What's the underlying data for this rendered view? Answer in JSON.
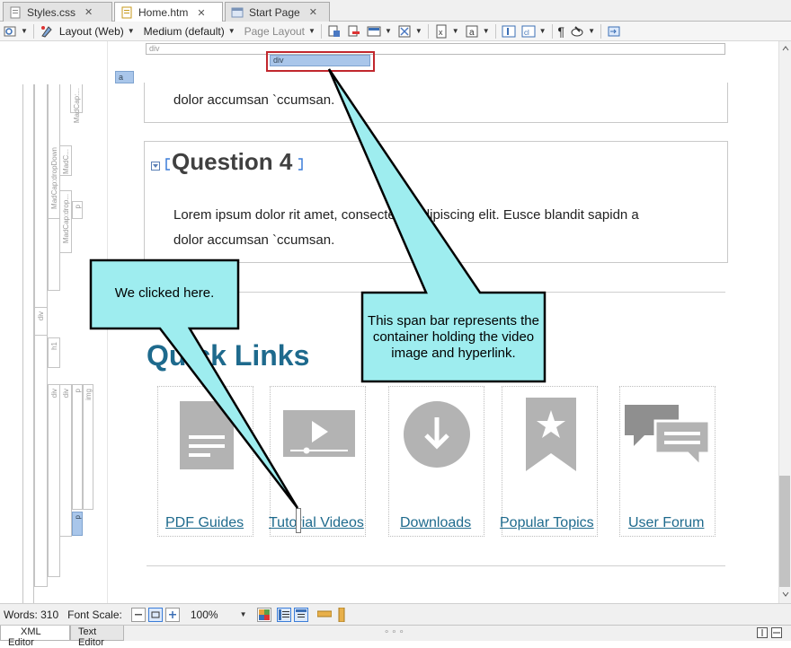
{
  "tabs": [
    {
      "label": "Styles.css",
      "icon": "css-file-icon",
      "active": false
    },
    {
      "label": "Home.htm",
      "icon": "htm-file-icon",
      "active": true
    },
    {
      "label": "Start Page",
      "icon": "start-page-icon",
      "active": false
    }
  ],
  "tab_close_glyph": "✕",
  "toolbar": {
    "layout_label": "Layout (Web)",
    "medium_label": "Medium (default)",
    "page_layout_label": "Page Layout",
    "pilcrow": "¶"
  },
  "structure": {
    "div_bar_label": "div",
    "span_bar_label": "div",
    "a_tag_label": "a",
    "gutter_labels": [
      "MadCap:...",
      "MadCap:dropDown",
      "MadC...",
      "MadCap:drop...",
      "p",
      "MadCap:drop...",
      "div",
      "h1",
      "div",
      "div",
      "p",
      "img",
      "p"
    ]
  },
  "content": {
    "prev_answer_tail": "dolor accumsan `ccumsan.",
    "q4_title": "Question 4",
    "q4_line1": "Lorem ipsum dolor rit amet, consectetur adipiscing elit. Eusce blandit sapidn a",
    "q4_line2": "dolor accumsan `ccumsan.",
    "quick_links_title": "Quick Links",
    "cards": [
      {
        "label": "PDF Guides",
        "icon": "document-icon"
      },
      {
        "label": "Tutorial Videos",
        "icon": "video-player-icon"
      },
      {
        "label": "Downloads",
        "icon": "download-icon"
      },
      {
        "label": "Popular Topics",
        "icon": "bookmark-star-icon"
      },
      {
        "label": "User Forum",
        "icon": "chat-bubbles-icon"
      }
    ]
  },
  "callouts": {
    "clicked": "We clicked here.",
    "span_bar": "This span bar represents the container holding the video image and hyperlink."
  },
  "status": {
    "words": "Words: 310",
    "font_scale_label": "Font Scale:",
    "zoom": "100%"
  },
  "bottom_tabs": {
    "xml_editor": "XML Editor",
    "text_editor": "Text Editor"
  },
  "colors": {
    "accent_link": "#1e6a8d",
    "callout_fill": "#9eedef",
    "highlight_border": "#c1272d",
    "span_bar_fill": "#a9c6ea"
  }
}
